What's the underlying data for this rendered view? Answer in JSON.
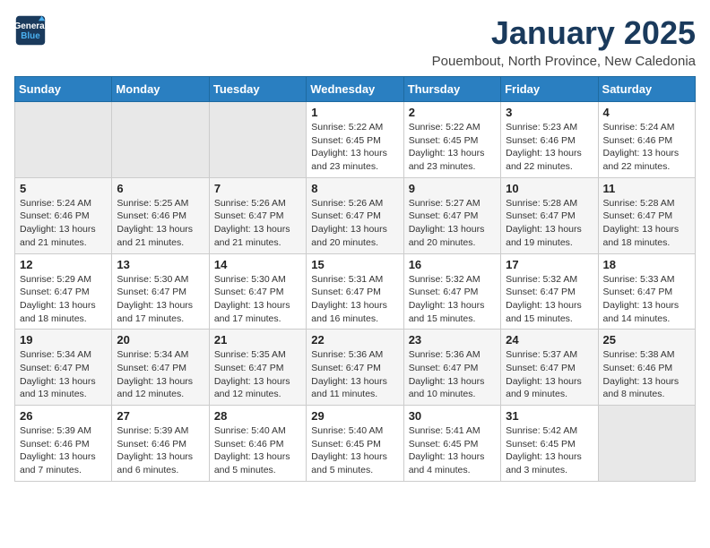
{
  "header": {
    "logo_line1": "General",
    "logo_line2": "Blue",
    "month": "January 2025",
    "location": "Pouembout, North Province, New Caledonia"
  },
  "weekdays": [
    "Sunday",
    "Monday",
    "Tuesday",
    "Wednesday",
    "Thursday",
    "Friday",
    "Saturday"
  ],
  "weeks": [
    [
      {
        "day": "",
        "info": ""
      },
      {
        "day": "",
        "info": ""
      },
      {
        "day": "",
        "info": ""
      },
      {
        "day": "1",
        "info": "Sunrise: 5:22 AM\nSunset: 6:45 PM\nDaylight: 13 hours\nand 23 minutes."
      },
      {
        "day": "2",
        "info": "Sunrise: 5:22 AM\nSunset: 6:45 PM\nDaylight: 13 hours\nand 23 minutes."
      },
      {
        "day": "3",
        "info": "Sunrise: 5:23 AM\nSunset: 6:46 PM\nDaylight: 13 hours\nand 22 minutes."
      },
      {
        "day": "4",
        "info": "Sunrise: 5:24 AM\nSunset: 6:46 PM\nDaylight: 13 hours\nand 22 minutes."
      }
    ],
    [
      {
        "day": "5",
        "info": "Sunrise: 5:24 AM\nSunset: 6:46 PM\nDaylight: 13 hours\nand 21 minutes."
      },
      {
        "day": "6",
        "info": "Sunrise: 5:25 AM\nSunset: 6:46 PM\nDaylight: 13 hours\nand 21 minutes."
      },
      {
        "day": "7",
        "info": "Sunrise: 5:26 AM\nSunset: 6:47 PM\nDaylight: 13 hours\nand 21 minutes."
      },
      {
        "day": "8",
        "info": "Sunrise: 5:26 AM\nSunset: 6:47 PM\nDaylight: 13 hours\nand 20 minutes."
      },
      {
        "day": "9",
        "info": "Sunrise: 5:27 AM\nSunset: 6:47 PM\nDaylight: 13 hours\nand 20 minutes."
      },
      {
        "day": "10",
        "info": "Sunrise: 5:28 AM\nSunset: 6:47 PM\nDaylight: 13 hours\nand 19 minutes."
      },
      {
        "day": "11",
        "info": "Sunrise: 5:28 AM\nSunset: 6:47 PM\nDaylight: 13 hours\nand 18 minutes."
      }
    ],
    [
      {
        "day": "12",
        "info": "Sunrise: 5:29 AM\nSunset: 6:47 PM\nDaylight: 13 hours\nand 18 minutes."
      },
      {
        "day": "13",
        "info": "Sunrise: 5:30 AM\nSunset: 6:47 PM\nDaylight: 13 hours\nand 17 minutes."
      },
      {
        "day": "14",
        "info": "Sunrise: 5:30 AM\nSunset: 6:47 PM\nDaylight: 13 hours\nand 17 minutes."
      },
      {
        "day": "15",
        "info": "Sunrise: 5:31 AM\nSunset: 6:47 PM\nDaylight: 13 hours\nand 16 minutes."
      },
      {
        "day": "16",
        "info": "Sunrise: 5:32 AM\nSunset: 6:47 PM\nDaylight: 13 hours\nand 15 minutes."
      },
      {
        "day": "17",
        "info": "Sunrise: 5:32 AM\nSunset: 6:47 PM\nDaylight: 13 hours\nand 15 minutes."
      },
      {
        "day": "18",
        "info": "Sunrise: 5:33 AM\nSunset: 6:47 PM\nDaylight: 13 hours\nand 14 minutes."
      }
    ],
    [
      {
        "day": "19",
        "info": "Sunrise: 5:34 AM\nSunset: 6:47 PM\nDaylight: 13 hours\nand 13 minutes."
      },
      {
        "day": "20",
        "info": "Sunrise: 5:34 AM\nSunset: 6:47 PM\nDaylight: 13 hours\nand 12 minutes."
      },
      {
        "day": "21",
        "info": "Sunrise: 5:35 AM\nSunset: 6:47 PM\nDaylight: 13 hours\nand 12 minutes."
      },
      {
        "day": "22",
        "info": "Sunrise: 5:36 AM\nSunset: 6:47 PM\nDaylight: 13 hours\nand 11 minutes."
      },
      {
        "day": "23",
        "info": "Sunrise: 5:36 AM\nSunset: 6:47 PM\nDaylight: 13 hours\nand 10 minutes."
      },
      {
        "day": "24",
        "info": "Sunrise: 5:37 AM\nSunset: 6:47 PM\nDaylight: 13 hours\nand 9 minutes."
      },
      {
        "day": "25",
        "info": "Sunrise: 5:38 AM\nSunset: 6:46 PM\nDaylight: 13 hours\nand 8 minutes."
      }
    ],
    [
      {
        "day": "26",
        "info": "Sunrise: 5:39 AM\nSunset: 6:46 PM\nDaylight: 13 hours\nand 7 minutes."
      },
      {
        "day": "27",
        "info": "Sunrise: 5:39 AM\nSunset: 6:46 PM\nDaylight: 13 hours\nand 6 minutes."
      },
      {
        "day": "28",
        "info": "Sunrise: 5:40 AM\nSunset: 6:46 PM\nDaylight: 13 hours\nand 5 minutes."
      },
      {
        "day": "29",
        "info": "Sunrise: 5:40 AM\nSunset: 6:45 PM\nDaylight: 13 hours\nand 5 minutes."
      },
      {
        "day": "30",
        "info": "Sunrise: 5:41 AM\nSunset: 6:45 PM\nDaylight: 13 hours\nand 4 minutes."
      },
      {
        "day": "31",
        "info": "Sunrise: 5:42 AM\nSunset: 6:45 PM\nDaylight: 13 hours\nand 3 minutes."
      },
      {
        "day": "",
        "info": ""
      }
    ]
  ]
}
